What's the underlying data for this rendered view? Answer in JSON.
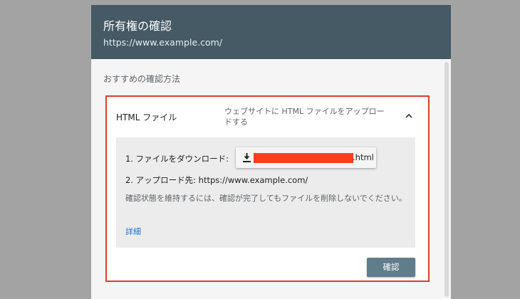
{
  "dialog": {
    "title": "所有権の確認",
    "property_url": "https://www.example.com/",
    "recommended_label": "おすすめの確認方法"
  },
  "method": {
    "name": "HTML ファイル",
    "description": "ウェブサイトに HTML ファイルをアップロードする",
    "expanded_icon": "chevron-up-icon",
    "steps": {
      "step1_label": "1. ファイルをダウンロード:",
      "download_icon": "download-icon",
      "download_file_ext": ".html",
      "step2_label": "2. アップロード先: https://www.example.com/",
      "note": "確認状態を維持するには、確認が完了してもファイルを削除しないでください。",
      "details_link": "詳細"
    },
    "verify_button": "確認"
  },
  "colors": {
    "header_bg": "#455a64",
    "highlight_border": "#e43b2c",
    "redaction": "#ff3c1e",
    "verify_button_bg": "#607d8b",
    "link": "#1a73e8"
  }
}
